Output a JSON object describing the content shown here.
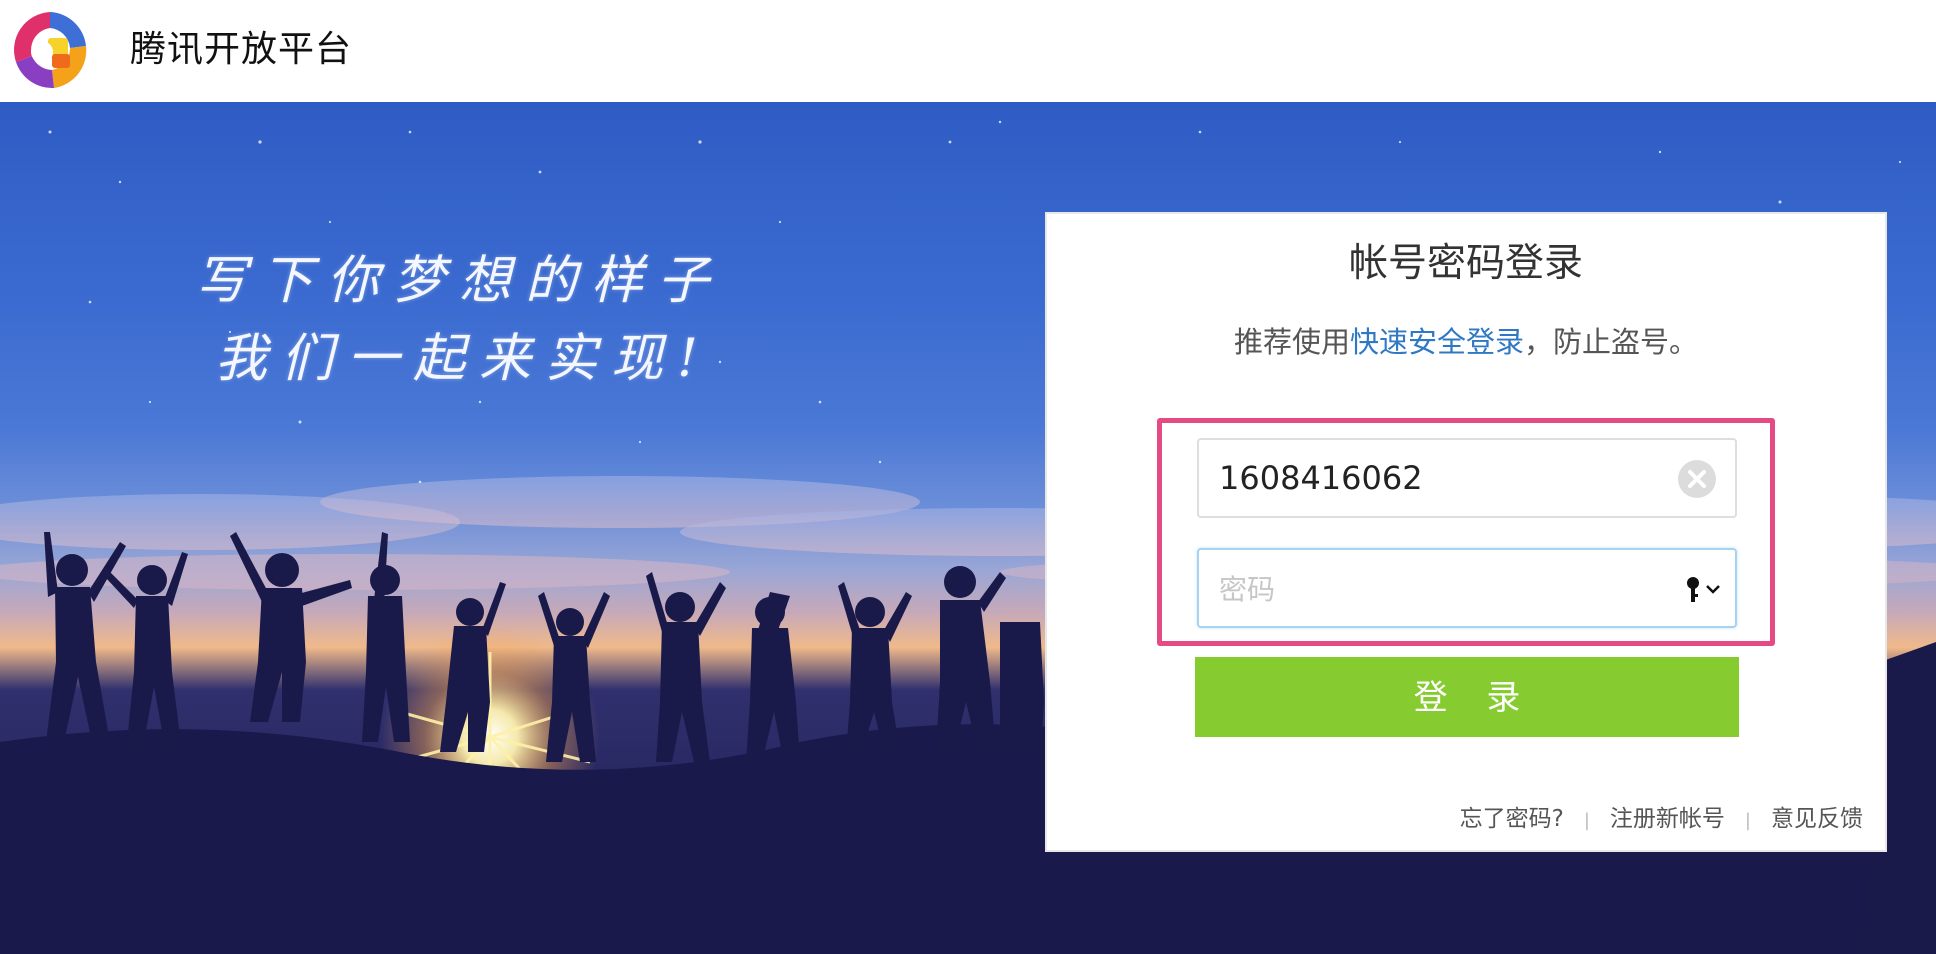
{
  "header": {
    "brand": "腾讯开放平台",
    "logo_icon": "tencent-open-platform-logo"
  },
  "hero": {
    "slogan_line1": "写下你梦想的样子",
    "slogan_line2": "我们一起来实现!"
  },
  "login": {
    "title": "帐号密码登录",
    "tip_prefix": "推荐使用",
    "tip_link": "快速安全登录",
    "tip_suffix": "，防止盗号。",
    "account_value": "1608416062",
    "password_placeholder": "密码",
    "clear_icon": "clear-icon",
    "key_icon": "password-key-icon",
    "submit_label": "登 录",
    "links": {
      "forgot": "忘了密码?",
      "register": "注册新帐号",
      "feedback": "意见反馈"
    },
    "separator": "|"
  },
  "colors": {
    "accent_green": "#86cc30",
    "link_blue": "#2f78c4",
    "highlight_pink": "#e64a85"
  }
}
